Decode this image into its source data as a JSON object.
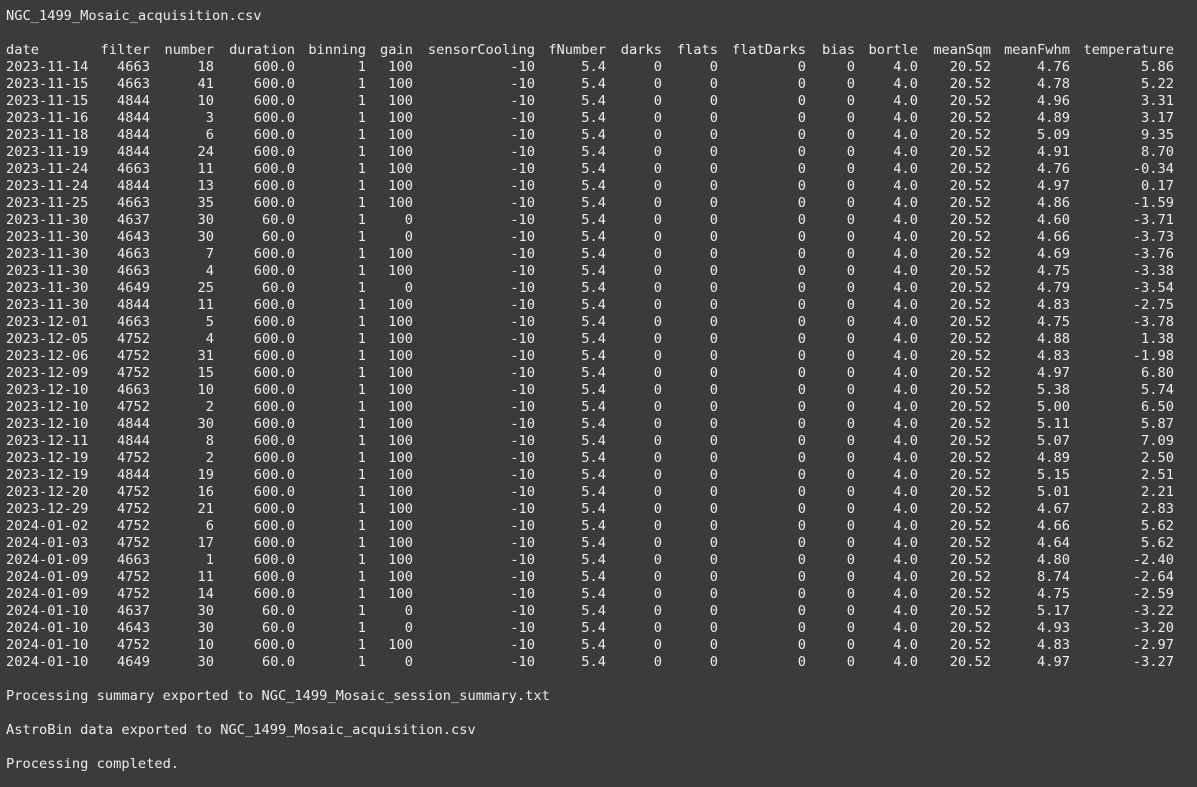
{
  "window": {
    "filename_line": "NGC_1499_Mosaic_acquisition.csv"
  },
  "table": {
    "columns": [
      "date",
      "filter",
      "number",
      "duration",
      "binning",
      "gain",
      "sensorCooling",
      "fNumber",
      "darks",
      "flats",
      "flatDarks",
      "bias",
      "bortle",
      "meanSqm",
      "meanFwhm",
      "temperature"
    ],
    "rows": [
      [
        "2023-11-14",
        "4663",
        "18",
        "600.0",
        "1",
        "100",
        "-10",
        "5.4",
        "0",
        "0",
        "0",
        "0",
        "4.0",
        "20.52",
        "4.76",
        "5.86"
      ],
      [
        "2023-11-15",
        "4663",
        "41",
        "600.0",
        "1",
        "100",
        "-10",
        "5.4",
        "0",
        "0",
        "0",
        "0",
        "4.0",
        "20.52",
        "4.78",
        "5.22"
      ],
      [
        "2023-11-15",
        "4844",
        "10",
        "600.0",
        "1",
        "100",
        "-10",
        "5.4",
        "0",
        "0",
        "0",
        "0",
        "4.0",
        "20.52",
        "4.96",
        "3.31"
      ],
      [
        "2023-11-16",
        "4844",
        "3",
        "600.0",
        "1",
        "100",
        "-10",
        "5.4",
        "0",
        "0",
        "0",
        "0",
        "4.0",
        "20.52",
        "4.89",
        "3.17"
      ],
      [
        "2023-11-18",
        "4844",
        "6",
        "600.0",
        "1",
        "100",
        "-10",
        "5.4",
        "0",
        "0",
        "0",
        "0",
        "4.0",
        "20.52",
        "5.09",
        "9.35"
      ],
      [
        "2023-11-19",
        "4844",
        "24",
        "600.0",
        "1",
        "100",
        "-10",
        "5.4",
        "0",
        "0",
        "0",
        "0",
        "4.0",
        "20.52",
        "4.91",
        "8.70"
      ],
      [
        "2023-11-24",
        "4663",
        "11",
        "600.0",
        "1",
        "100",
        "-10",
        "5.4",
        "0",
        "0",
        "0",
        "0",
        "4.0",
        "20.52",
        "4.76",
        "-0.34"
      ],
      [
        "2023-11-24",
        "4844",
        "13",
        "600.0",
        "1",
        "100",
        "-10",
        "5.4",
        "0",
        "0",
        "0",
        "0",
        "4.0",
        "20.52",
        "4.97",
        "0.17"
      ],
      [
        "2023-11-25",
        "4663",
        "35",
        "600.0",
        "1",
        "100",
        "-10",
        "5.4",
        "0",
        "0",
        "0",
        "0",
        "4.0",
        "20.52",
        "4.86",
        "-1.59"
      ],
      [
        "2023-11-30",
        "4637",
        "30",
        "60.0",
        "1",
        "0",
        "-10",
        "5.4",
        "0",
        "0",
        "0",
        "0",
        "4.0",
        "20.52",
        "4.60",
        "-3.71"
      ],
      [
        "2023-11-30",
        "4643",
        "30",
        "60.0",
        "1",
        "0",
        "-10",
        "5.4",
        "0",
        "0",
        "0",
        "0",
        "4.0",
        "20.52",
        "4.66",
        "-3.73"
      ],
      [
        "2023-11-30",
        "4663",
        "7",
        "600.0",
        "1",
        "100",
        "-10",
        "5.4",
        "0",
        "0",
        "0",
        "0",
        "4.0",
        "20.52",
        "4.69",
        "-3.76"
      ],
      [
        "2023-11-30",
        "4663",
        "4",
        "600.0",
        "1",
        "100",
        "-10",
        "5.4",
        "0",
        "0",
        "0",
        "0",
        "4.0",
        "20.52",
        "4.75",
        "-3.38"
      ],
      [
        "2023-11-30",
        "4649",
        "25",
        "60.0",
        "1",
        "0",
        "-10",
        "5.4",
        "0",
        "0",
        "0",
        "0",
        "4.0",
        "20.52",
        "4.79",
        "-3.54"
      ],
      [
        "2023-11-30",
        "4844",
        "11",
        "600.0",
        "1",
        "100",
        "-10",
        "5.4",
        "0",
        "0",
        "0",
        "0",
        "4.0",
        "20.52",
        "4.83",
        "-2.75"
      ],
      [
        "2023-12-01",
        "4663",
        "5",
        "600.0",
        "1",
        "100",
        "-10",
        "5.4",
        "0",
        "0",
        "0",
        "0",
        "4.0",
        "20.52",
        "4.75",
        "-3.78"
      ],
      [
        "2023-12-05",
        "4752",
        "4",
        "600.0",
        "1",
        "100",
        "-10",
        "5.4",
        "0",
        "0",
        "0",
        "0",
        "4.0",
        "20.52",
        "4.88",
        "1.38"
      ],
      [
        "2023-12-06",
        "4752",
        "31",
        "600.0",
        "1",
        "100",
        "-10",
        "5.4",
        "0",
        "0",
        "0",
        "0",
        "4.0",
        "20.52",
        "4.83",
        "-1.98"
      ],
      [
        "2023-12-09",
        "4752",
        "15",
        "600.0",
        "1",
        "100",
        "-10",
        "5.4",
        "0",
        "0",
        "0",
        "0",
        "4.0",
        "20.52",
        "4.97",
        "6.80"
      ],
      [
        "2023-12-10",
        "4663",
        "10",
        "600.0",
        "1",
        "100",
        "-10",
        "5.4",
        "0",
        "0",
        "0",
        "0",
        "4.0",
        "20.52",
        "5.38",
        "5.74"
      ],
      [
        "2023-12-10",
        "4752",
        "2",
        "600.0",
        "1",
        "100",
        "-10",
        "5.4",
        "0",
        "0",
        "0",
        "0",
        "4.0",
        "20.52",
        "5.00",
        "6.50"
      ],
      [
        "2023-12-10",
        "4844",
        "30",
        "600.0",
        "1",
        "100",
        "-10",
        "5.4",
        "0",
        "0",
        "0",
        "0",
        "4.0",
        "20.52",
        "5.11",
        "5.87"
      ],
      [
        "2023-12-11",
        "4844",
        "8",
        "600.0",
        "1",
        "100",
        "-10",
        "5.4",
        "0",
        "0",
        "0",
        "0",
        "4.0",
        "20.52",
        "5.07",
        "7.09"
      ],
      [
        "2023-12-19",
        "4752",
        "2",
        "600.0",
        "1",
        "100",
        "-10",
        "5.4",
        "0",
        "0",
        "0",
        "0",
        "4.0",
        "20.52",
        "4.89",
        "2.50"
      ],
      [
        "2023-12-19",
        "4844",
        "19",
        "600.0",
        "1",
        "100",
        "-10",
        "5.4",
        "0",
        "0",
        "0",
        "0",
        "4.0",
        "20.52",
        "5.15",
        "2.51"
      ],
      [
        "2023-12-20",
        "4752",
        "16",
        "600.0",
        "1",
        "100",
        "-10",
        "5.4",
        "0",
        "0",
        "0",
        "0",
        "4.0",
        "20.52",
        "5.01",
        "2.21"
      ],
      [
        "2023-12-29",
        "4752",
        "21",
        "600.0",
        "1",
        "100",
        "-10",
        "5.4",
        "0",
        "0",
        "0",
        "0",
        "4.0",
        "20.52",
        "4.67",
        "2.83"
      ],
      [
        "2024-01-02",
        "4752",
        "6",
        "600.0",
        "1",
        "100",
        "-10",
        "5.4",
        "0",
        "0",
        "0",
        "0",
        "4.0",
        "20.52",
        "4.66",
        "5.62"
      ],
      [
        "2024-01-03",
        "4752",
        "17",
        "600.0",
        "1",
        "100",
        "-10",
        "5.4",
        "0",
        "0",
        "0",
        "0",
        "4.0",
        "20.52",
        "4.64",
        "5.62"
      ],
      [
        "2024-01-09",
        "4663",
        "1",
        "600.0",
        "1",
        "100",
        "-10",
        "5.4",
        "0",
        "0",
        "0",
        "0",
        "4.0",
        "20.52",
        "4.80",
        "-2.40"
      ],
      [
        "2024-01-09",
        "4752",
        "11",
        "600.0",
        "1",
        "100",
        "-10",
        "5.4",
        "0",
        "0",
        "0",
        "0",
        "4.0",
        "20.52",
        "8.74",
        "-2.64"
      ],
      [
        "2024-01-09",
        "4752",
        "14",
        "600.0",
        "1",
        "100",
        "-10",
        "5.4",
        "0",
        "0",
        "0",
        "0",
        "4.0",
        "20.52",
        "4.75",
        "-2.59"
      ],
      [
        "2024-01-10",
        "4637",
        "30",
        "60.0",
        "1",
        "0",
        "-10",
        "5.4",
        "0",
        "0",
        "0",
        "0",
        "4.0",
        "20.52",
        "5.17",
        "-3.22"
      ],
      [
        "2024-01-10",
        "4643",
        "30",
        "60.0",
        "1",
        "0",
        "-10",
        "5.4",
        "0",
        "0",
        "0",
        "0",
        "4.0",
        "20.52",
        "4.93",
        "-3.20"
      ],
      [
        "2024-01-10",
        "4752",
        "10",
        "600.0",
        "1",
        "100",
        "-10",
        "5.4",
        "0",
        "0",
        "0",
        "0",
        "4.0",
        "20.52",
        "4.83",
        "-2.97"
      ],
      [
        "2024-01-10",
        "4649",
        "30",
        "60.0",
        "1",
        "0",
        "-10",
        "5.4",
        "0",
        "0",
        "0",
        "0",
        "4.0",
        "20.52",
        "4.97",
        "-3.27"
      ]
    ]
  },
  "messages": {
    "summary_exported": "Processing summary exported to NGC_1499_Mosaic_session_summary.txt",
    "astrobin_exported": "AstroBin data exported to NGC_1499_Mosaic_acquisition.csv",
    "completed": "Processing completed."
  },
  "colors": {
    "background": "#3b3b3b",
    "text": "#ececec"
  }
}
